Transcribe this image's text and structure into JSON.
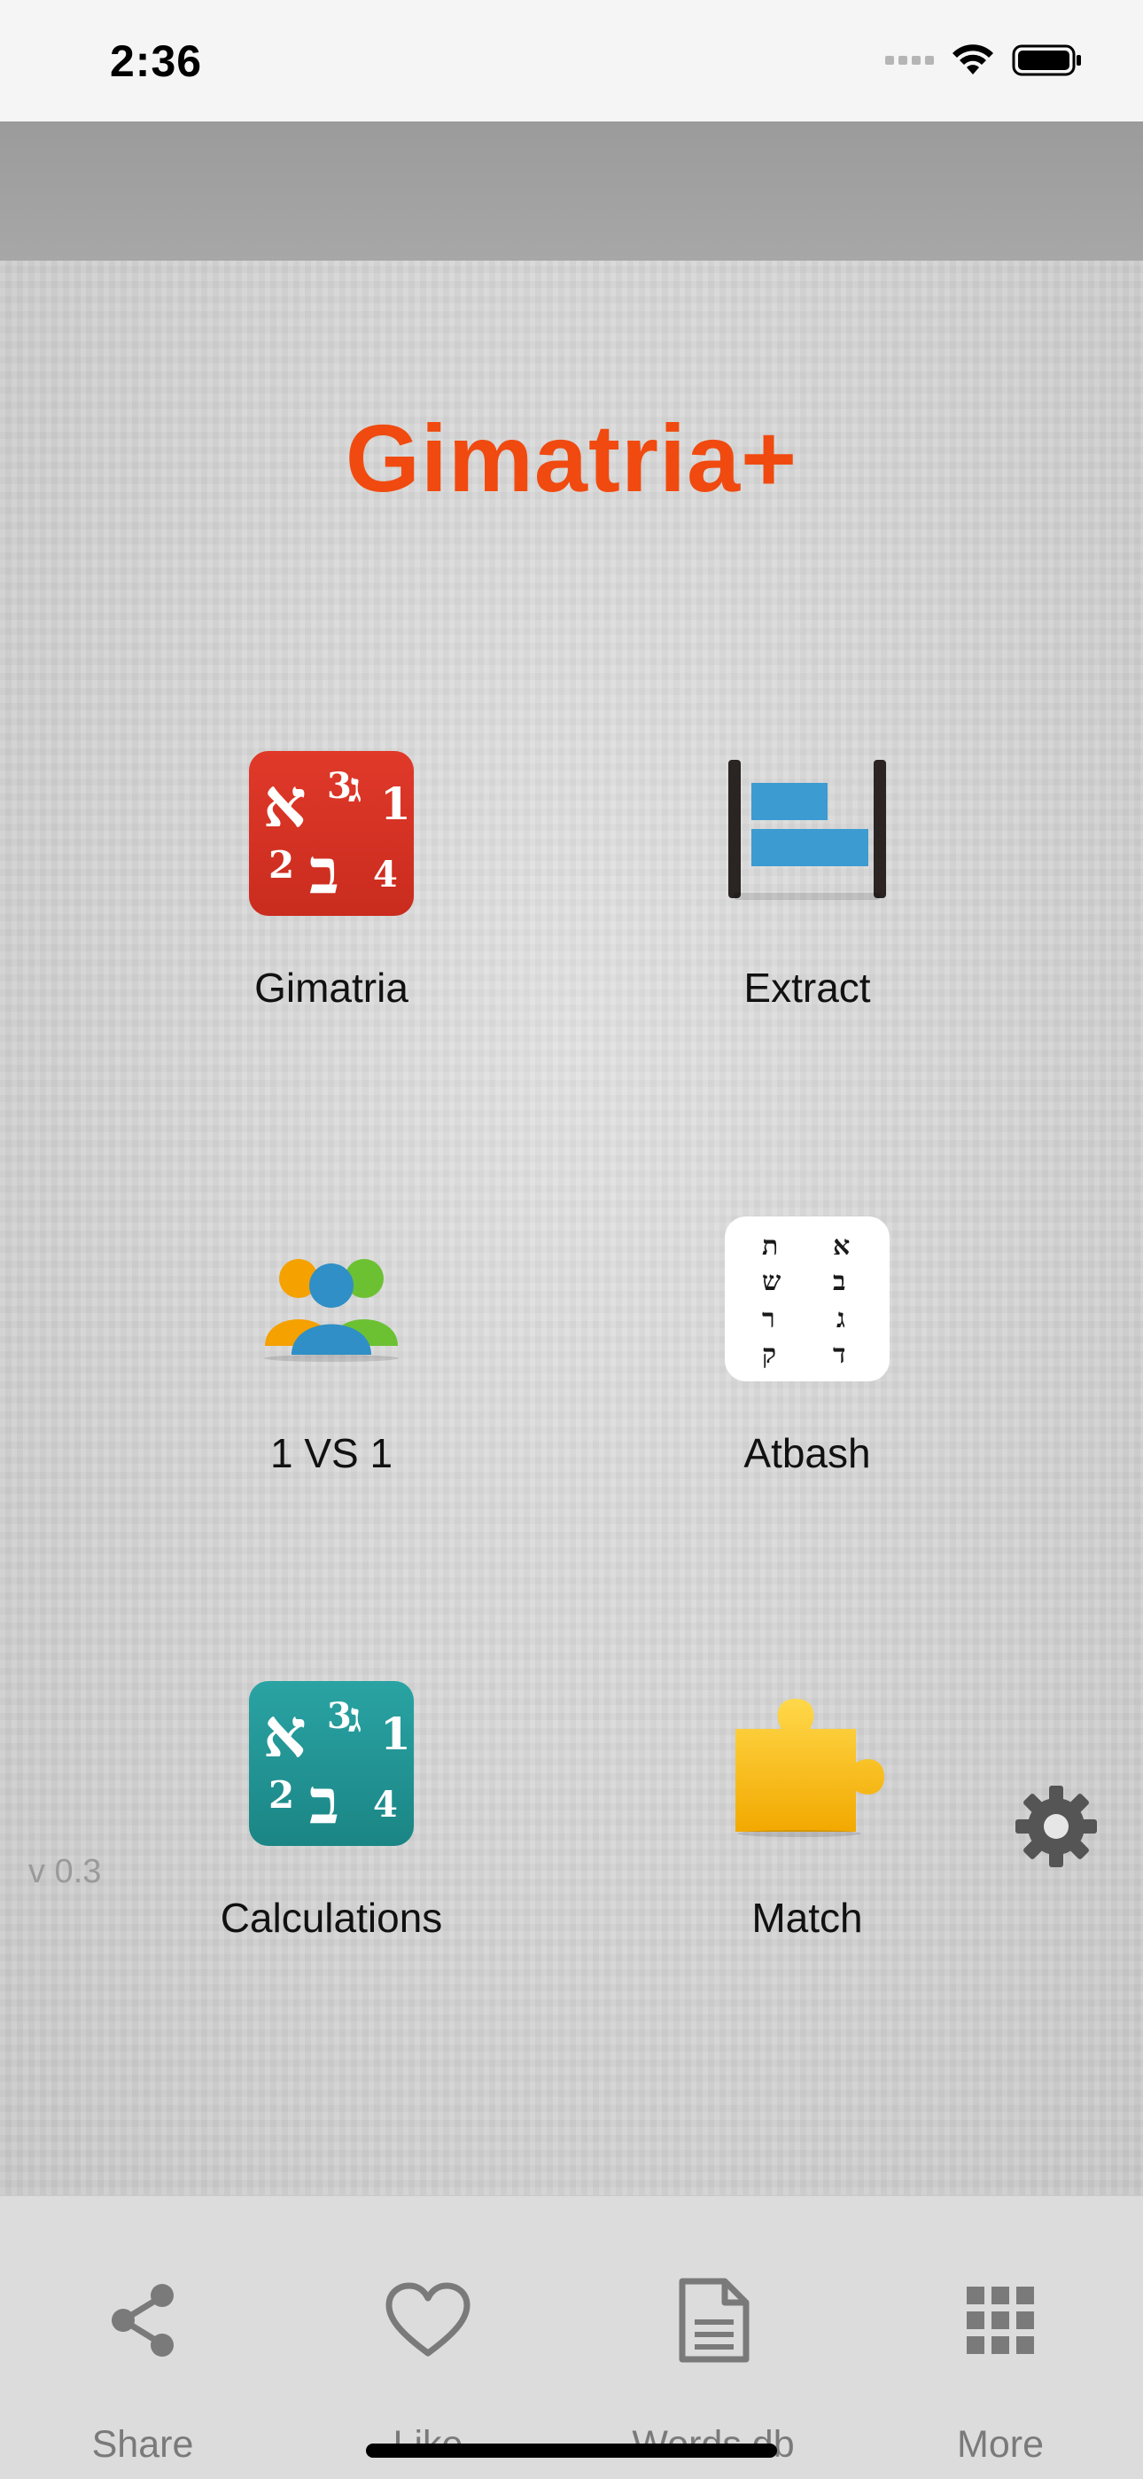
{
  "status_bar": {
    "time": "2:36"
  },
  "app": {
    "title": "Gimatria+",
    "version": "v 0.3"
  },
  "tiles": [
    {
      "label": "Gimatria",
      "icon": "gimatria-icon"
    },
    {
      "label": "Extract",
      "icon": "extract-icon"
    },
    {
      "label": "1 VS 1",
      "icon": "users-icon"
    },
    {
      "label": "Atbash",
      "icon": "atbash-icon"
    },
    {
      "label": "Calculations",
      "icon": "calculations-icon"
    },
    {
      "label": "Match",
      "icon": "puzzle-icon"
    }
  ],
  "gimatria_glyphs": {
    "a": "א",
    "g": "ג",
    "b": "ב",
    "n3": "3",
    "n1": "1",
    "n2": "2",
    "n4": "4"
  },
  "atbash_glyphs": [
    "ת",
    "א",
    "ש",
    "ב",
    "ר",
    "ג",
    "ק",
    "ד"
  ],
  "tabbar": [
    {
      "label": "Share",
      "icon": "share-icon"
    },
    {
      "label": "Like",
      "icon": "heart-icon"
    },
    {
      "label": "Words db",
      "icon": "document-icon"
    },
    {
      "label": "More",
      "icon": "grid-icon"
    }
  ],
  "colors": {
    "title": "#f04a10",
    "gimatria_red": "#d9331f",
    "calc_teal": "#249a9a",
    "extract_blue": "#3c9bd0",
    "tab_gray": "#7a7a7a",
    "puzzle_yellow": "#f5b800"
  }
}
